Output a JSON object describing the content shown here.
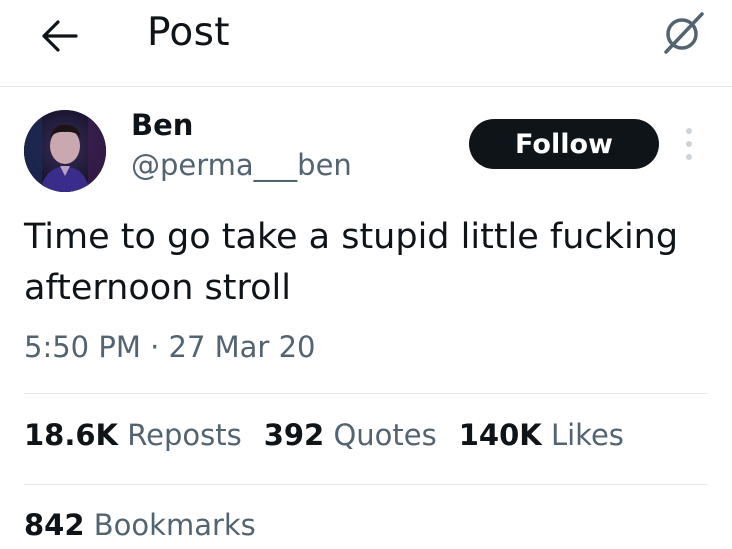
{
  "header": {
    "title": "Post",
    "back_icon": "arrow-left-icon",
    "grok_icon": "grok-icon"
  },
  "author": {
    "name": "Ben",
    "handle": "@perma___ben",
    "follow_label": "Follow"
  },
  "post": {
    "text": "Time to go take a stupid little fucking afternoon stroll",
    "time": "5:50 PM",
    "separator": "·",
    "date": "27 Mar 20"
  },
  "stats": {
    "reposts_count": "18.6K",
    "reposts_label": "Reposts",
    "quotes_count": "392",
    "quotes_label": "Quotes",
    "likes_count": "140K",
    "likes_label": "Likes",
    "bookmarks_count": "842",
    "bookmarks_label": "Bookmarks"
  },
  "colors": {
    "text_primary": "#0f1419",
    "text_secondary": "#536471",
    "divider": "#e6e9ea",
    "button_bg": "#0f1419"
  }
}
